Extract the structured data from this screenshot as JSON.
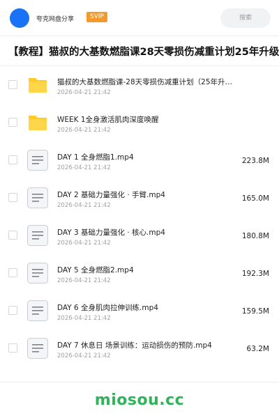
{
  "header": {
    "app_name": "夸克网盘分享",
    "badge": "SVIP",
    "search_placeholder": "搜索"
  },
  "page_title": "【教程】猫叔的大基数燃脂课28天零损伤减重计划25年升级",
  "files": [
    {
      "type": "folder",
      "name": "猫叔的大基数燃脂课-28天零损伤减重计划（25年升…",
      "date": "2026-04-21 21:42",
      "size": ""
    },
    {
      "type": "folder",
      "name": "WEEK 1全身激活肌肉深度唤醒",
      "date": "2026-04-21 21:42",
      "size": ""
    },
    {
      "type": "file",
      "name": "DAY 1 全身燃脂1.mp4",
      "date": "2026-04-21 21:42",
      "size": "223.8M"
    },
    {
      "type": "file",
      "name": "DAY 2 基础力量强化 · 手臂.mp4",
      "date": "2026-04-21 21:42",
      "size": "165.0M"
    },
    {
      "type": "file",
      "name": "DAY 3 基础力量强化 · 核心.mp4",
      "date": "2026-04-21 21:42",
      "size": "180.8M"
    },
    {
      "type": "file",
      "name": "DAY 5 全身燃脂2.mp4",
      "date": "2026-04-21 21:42",
      "size": "192.3M"
    },
    {
      "type": "file",
      "name": "DAY 6 全身肌肉拉伸训练.mp4",
      "date": "2026-04-21 21:42",
      "size": "159.5M"
    },
    {
      "type": "file",
      "name": "DAY 7 休息日 场景训练：运动损伤的预防.mp4",
      "date": "2026-04-21 21:42",
      "size": "63.2M"
    }
  ],
  "watermark": "miosou.cc",
  "colors": {
    "accent_blue": "#1a73f5",
    "svip_orange": "#f39a2c",
    "folder_yellow": "#ffc927",
    "watermark_green": "#2fb45a"
  }
}
